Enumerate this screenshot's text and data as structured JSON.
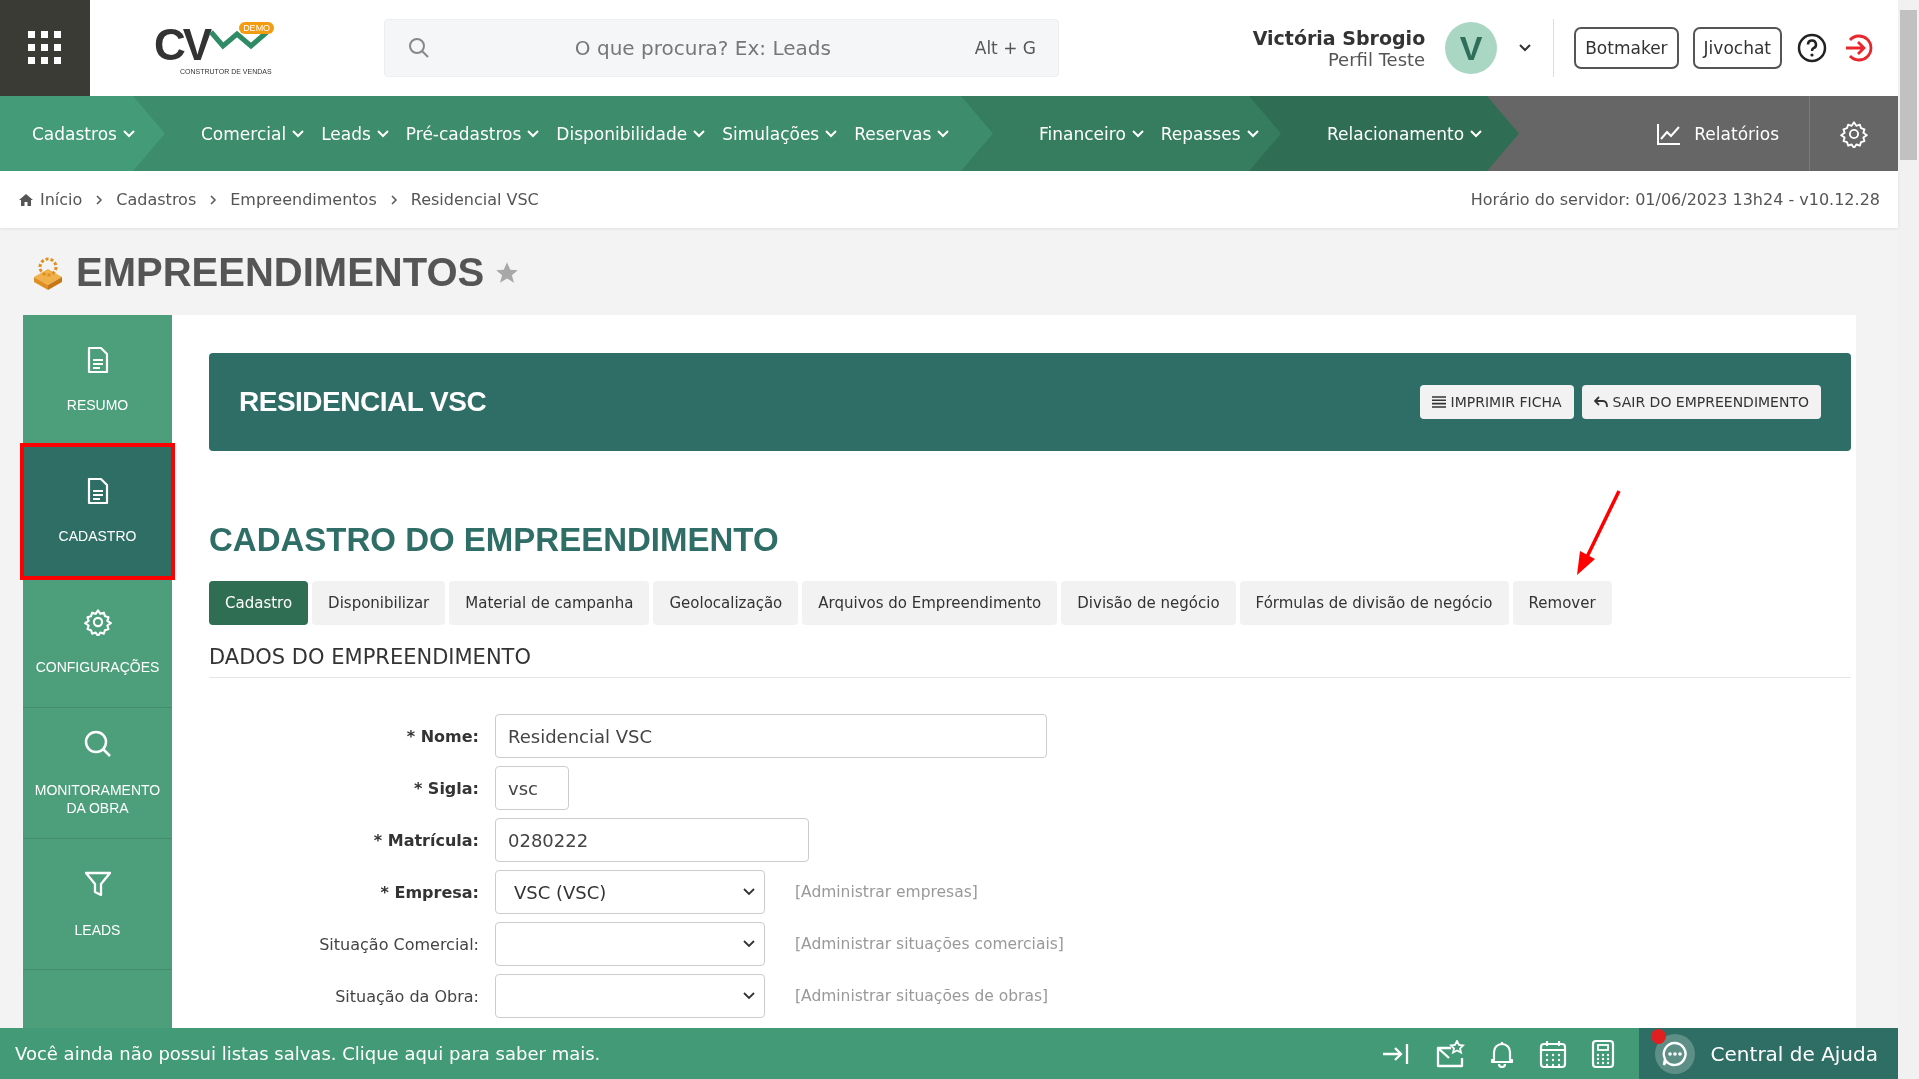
{
  "topbar": {
    "logo": {
      "mark": "CV",
      "badge": "DEMO",
      "tagline": "CONSTRUTOR DE VENDAS"
    },
    "search": {
      "placeholder": "O que procura? Ex: Leads",
      "shortcut": "Alt + G"
    },
    "user": {
      "name": "Victória Sbrogio",
      "profile": "Perfil Teste",
      "initial": "V"
    },
    "buttons": [
      "Botmaker",
      "Jivochat"
    ]
  },
  "nav": {
    "groups": [
      {
        "items": [
          "Cadastros"
        ]
      },
      {
        "items": [
          "Comercial",
          "Leads",
          "Pré-cadastros",
          "Disponibilidade",
          "Simulações",
          "Reservas"
        ]
      },
      {
        "items": [
          "Financeiro",
          "Repasses"
        ]
      },
      {
        "items": [
          "Relacionamento"
        ]
      }
    ],
    "reports": "Relatórios"
  },
  "breadcrumb": {
    "items": [
      "Início",
      "Cadastros",
      "Empreendimentos",
      "Residencial VSC"
    ],
    "server_time": "Horário do servidor: 01/06/2023 13h24 - v10.12.28"
  },
  "page": {
    "title": "EMPREENDIMENTOS",
    "favorite": false
  },
  "sidebar": [
    {
      "kind": "file",
      "label": "RESUMO",
      "selected": false,
      "highlighted": false
    },
    {
      "kind": "file",
      "label": "CADASTRO",
      "selected": true,
      "highlighted": true
    },
    {
      "kind": "gear",
      "label": "CONFIGURAÇÕES",
      "selected": false,
      "highlighted": false
    },
    {
      "kind": "search",
      "label": "MONITORAMENTO DA OBRA",
      "selected": false,
      "highlighted": false
    },
    {
      "kind": "filter",
      "label": "LEADS",
      "selected": false,
      "highlighted": false
    }
  ],
  "banner": {
    "title": "RESIDENCIAL VSC",
    "buttons": [
      {
        "kind": "list",
        "label": "IMPRIMIR FICHA"
      },
      {
        "kind": "reply",
        "label": "SAIR DO EMPREENDIMENTO"
      }
    ]
  },
  "section_title": "CADASTRO DO EMPREENDIMENTO",
  "tabs": [
    {
      "label": "Cadastro",
      "selected": true
    },
    {
      "label": "Disponibilizar",
      "selected": false
    },
    {
      "label": "Material de campanha",
      "selected": false
    },
    {
      "label": "Geolocalização",
      "selected": false
    },
    {
      "label": "Arquivos do Empreendimento",
      "selected": false
    },
    {
      "label": "Divisão de negócio",
      "selected": false
    },
    {
      "label": "Fórmulas de divisão de negócio",
      "selected": false
    },
    {
      "label": "Remover",
      "selected": false
    }
  ],
  "subsection": "DADOS DO EMPREENDIMENTO",
  "fields": [
    {
      "kind": "text",
      "label": "* Nome:",
      "required": true,
      "value": "Residencial VSC"
    },
    {
      "kind": "text",
      "label": "* Sigla:",
      "required": true,
      "value": "vsc"
    },
    {
      "kind": "text",
      "label": "* Matrícula:",
      "required": true,
      "value": "0280222"
    },
    {
      "kind": "select",
      "label": "* Empresa:",
      "required": true,
      "value": "VSC (VSC)",
      "link": "[Administrar empresas]"
    },
    {
      "kind": "select",
      "label": "Situação Comercial:",
      "required": false,
      "link": "[Administrar situações comerciais]"
    },
    {
      "kind": "select",
      "label": "Situação da Obra:",
      "required": false,
      "link": "[Administrar situações de obras]"
    }
  ],
  "footer": {
    "message": "Você ainda não possui listas salvas. Clique aqui para saber mais.",
    "help": "Central de Ajuda",
    "help_badge": true
  }
}
